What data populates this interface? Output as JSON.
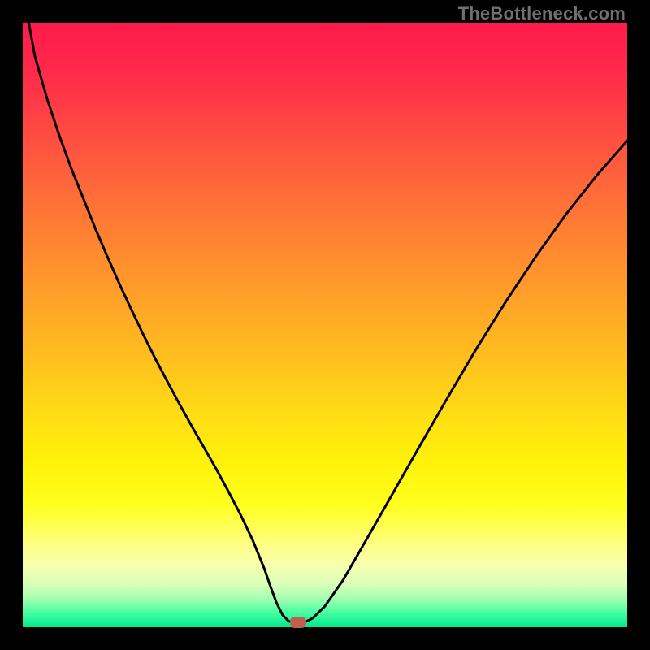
{
  "watermark": "TheBottleneck.com",
  "colors": {
    "curve_stroke": "#000000",
    "marker_fill": "#c1604f",
    "frame_bg": "#000000"
  },
  "chart_data": {
    "type": "line",
    "title": "",
    "xlabel": "",
    "ylabel": "",
    "xlim": [
      0,
      1
    ],
    "ylim": [
      0,
      1
    ],
    "x": [
      0.0,
      0.01,
      0.02,
      0.04,
      0.06,
      0.08,
      0.1,
      0.12,
      0.14,
      0.16,
      0.18,
      0.2,
      0.22,
      0.24,
      0.26,
      0.28,
      0.3,
      0.32,
      0.34,
      0.36,
      0.38,
      0.4,
      0.41,
      0.42,
      0.43,
      0.44,
      0.45,
      0.46,
      0.47,
      0.48,
      0.5,
      0.53,
      0.56,
      0.6,
      0.65,
      0.7,
      0.75,
      0.8,
      0.85,
      0.9,
      0.95,
      1.0
    ],
    "values": [
      1.06,
      1.0,
      0.945,
      0.875,
      0.815,
      0.76,
      0.71,
      0.66,
      0.613,
      0.568,
      0.525,
      0.483,
      0.443,
      0.405,
      0.368,
      0.332,
      0.297,
      0.262,
      0.225,
      0.187,
      0.145,
      0.096,
      0.067,
      0.04,
      0.02,
      0.01,
      0.008,
      0.008,
      0.01,
      0.015,
      0.035,
      0.078,
      0.13,
      0.2,
      0.288,
      0.375,
      0.46,
      0.54,
      0.615,
      0.685,
      0.748,
      0.805
    ],
    "marker": {
      "x": 0.455,
      "y": 0.008
    },
    "notes": "x and y are normalized to the plot area; y is fraction from bottom (0) to top (1). Values >1 indicate the curve starts above the visible top edge."
  }
}
